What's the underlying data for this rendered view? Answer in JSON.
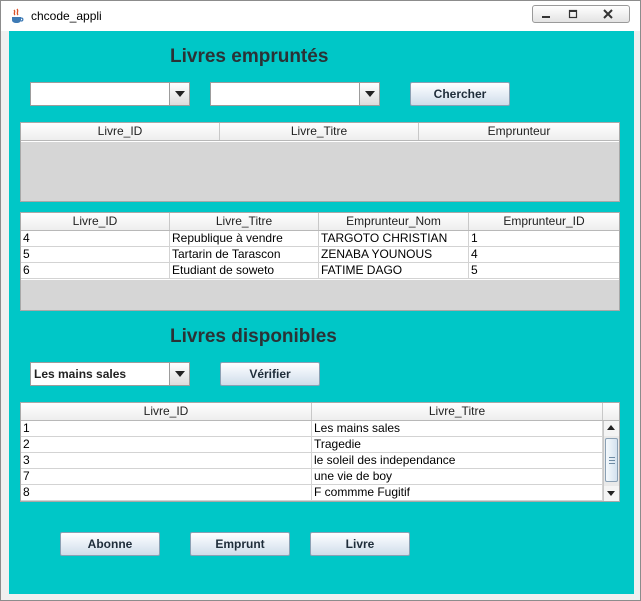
{
  "window": {
    "title": "chcode_appli"
  },
  "borrowed": {
    "heading": "Livres empruntés",
    "search_label": "Chercher",
    "search_table": {
      "columns": [
        "Livre_ID",
        "Livre_Titre",
        "Emprunteur"
      ]
    },
    "results_table": {
      "columns": [
        "Livre_ID",
        "Livre_Titre",
        "Emprunteur_Nom",
        "Emprunteur_ID"
      ],
      "rows": [
        [
          "4",
          "Republique à vendre",
          "TARGOTO CHRISTIAN",
          "1"
        ],
        [
          "5",
          "Tartarin de Tarascon",
          "ZENABA YOUNOUS",
          "4"
        ],
        [
          "6",
          "Etudiant de soweto",
          "FATIME DAGO",
          "5"
        ]
      ]
    }
  },
  "available": {
    "heading": "Livres disponibles",
    "combo_value": "Les mains sales",
    "verify_label": "Vérifier",
    "table": {
      "columns": [
        "Livre_ID",
        "Livre_Titre"
      ],
      "rows": [
        [
          "1",
          "Les mains sales"
        ],
        [
          "2",
          "Tragedie"
        ],
        [
          "3",
          "le soleil des independance"
        ],
        [
          "7",
          "une vie de boy"
        ],
        [
          "8",
          "F commme Fugitif"
        ]
      ]
    }
  },
  "footer": {
    "abonne": "Abonne",
    "emprunt": "Emprunt",
    "livre": "Livre"
  },
  "colors": {
    "panel_bg": "#00c7c7",
    "heading": "#2b3236"
  }
}
